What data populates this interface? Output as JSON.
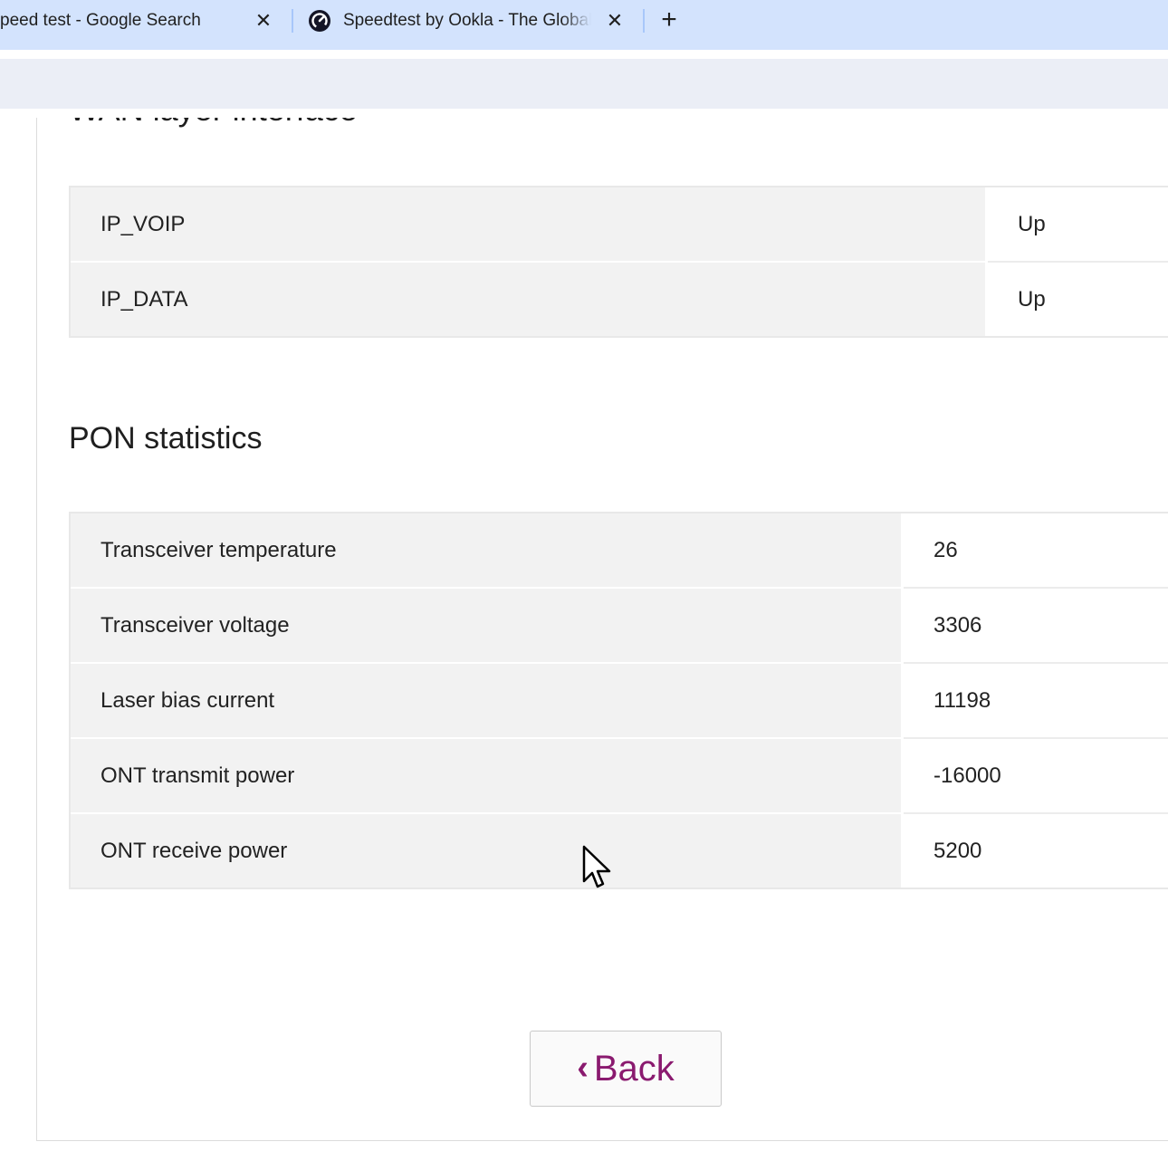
{
  "browser": {
    "tabs": [
      {
        "title": "peed test - Google Search",
        "close_label": "✕"
      },
      {
        "title": "Speedtest by Ookla - The Global Broadband Speed Test",
        "close_label": "✕",
        "favicon": "speedtest-gauge-icon"
      }
    ],
    "new_tab_label": "+",
    "colors": {
      "tabbar": "#d3e3fd",
      "toolbar": "#ebeef6"
    }
  },
  "page": {
    "cut_heading": "WAN layer interface",
    "wan_table": {
      "rows": [
        {
          "key": "IP_VOIP",
          "value": "Up"
        },
        {
          "key": "IP_DATA",
          "value": "Up"
        }
      ]
    },
    "pon_section_title": "PON statistics",
    "pon_table": {
      "rows": [
        {
          "key": "Transceiver temperature",
          "value": "26"
        },
        {
          "key": "Transceiver voltage",
          "value": "3306"
        },
        {
          "key": "Laser bias current",
          "value": "11198"
        },
        {
          "key": "ONT transmit power",
          "value": "-16000"
        },
        {
          "key": "ONT receive power",
          "value": "5200"
        }
      ]
    },
    "back_button": {
      "chevron": "‹",
      "label": "Back"
    },
    "colors": {
      "accent": "#8a1a6f",
      "key_cell_bg": "#f2f2f2"
    }
  }
}
